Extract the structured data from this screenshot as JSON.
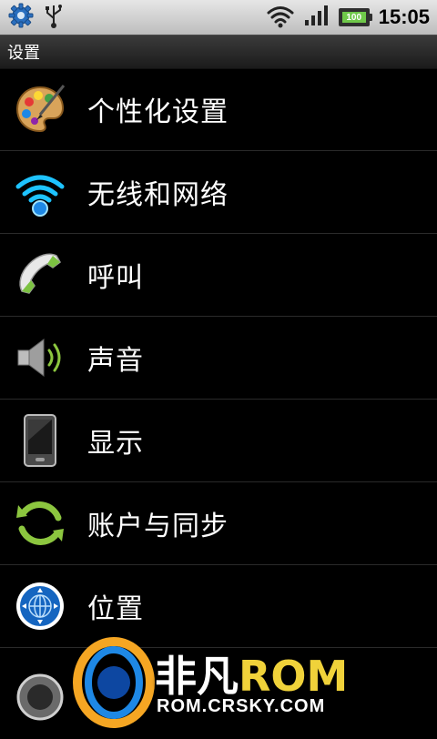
{
  "status_bar": {
    "time": "15:05",
    "battery_text": "100",
    "battery_level": 1.0,
    "icons": [
      "settings-icon",
      "usb-icon",
      "wifi-icon",
      "signal-icon",
      "battery-icon"
    ]
  },
  "header": {
    "title": "设置"
  },
  "list": {
    "items": [
      {
        "label": "个性化设置",
        "icon": "palette-icon"
      },
      {
        "label": "无线和网络",
        "icon": "wifi-icon"
      },
      {
        "label": "呼叫",
        "icon": "phone-icon"
      },
      {
        "label": "声音",
        "icon": "speaker-icon"
      },
      {
        "label": "显示",
        "icon": "display-icon"
      },
      {
        "label": "账户与同步",
        "icon": "sync-icon"
      },
      {
        "label": "位置",
        "icon": "globe-icon"
      }
    ]
  },
  "watermark": {
    "brand_cn": "非凡",
    "brand_rom": "ROM",
    "url": "ROM.CRSKY.COM"
  },
  "colors": {
    "accent_green": "#8cc63f",
    "accent_blue": "#1e88e5",
    "status_bar": "#d5d5d5"
  }
}
